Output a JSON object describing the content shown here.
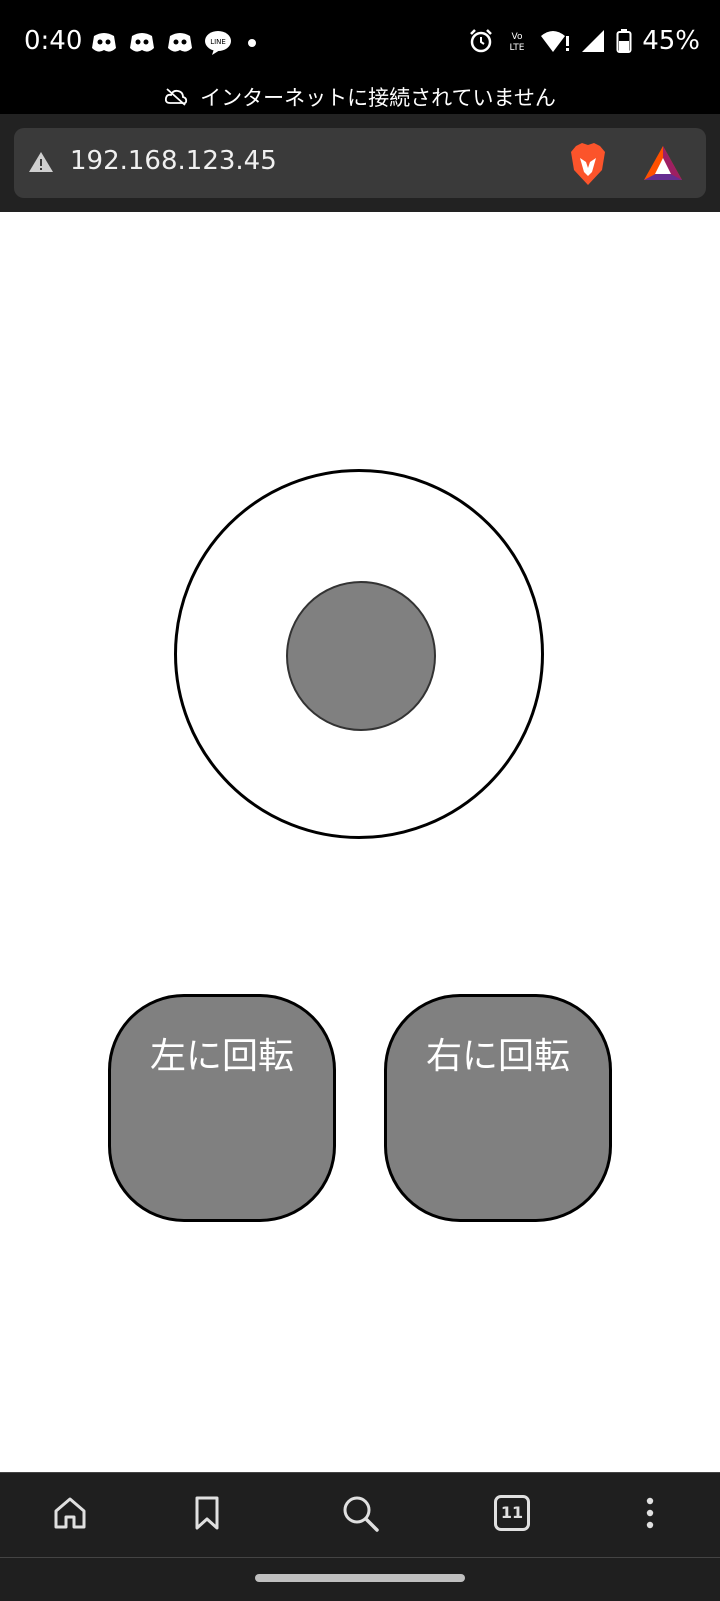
{
  "status_bar": {
    "time": "0:40",
    "battery": "45%",
    "notification_icons": [
      "discord-icon",
      "discord-icon",
      "discord-icon",
      "line-icon",
      "dot-icon"
    ],
    "system_icons": [
      "alarm-icon",
      "volte-icon",
      "wifi-icon",
      "signal-icon",
      "battery-icon"
    ]
  },
  "offline_banner": {
    "text": "インターネットに接続されていません"
  },
  "browser": {
    "url": "192.168.123.45",
    "icons": [
      "warning-icon",
      "brave-shields-icon",
      "brave-rewards-icon"
    ]
  },
  "controls": {
    "rotate_left_label": "左に回転",
    "rotate_right_label": "右に回転"
  },
  "bottom_nav": {
    "tabs_count": "11",
    "icons": [
      "home-icon",
      "bookmark-icon",
      "search-icon",
      "tabs-icon",
      "more-icon"
    ]
  },
  "colors": {
    "button_fill": "#808080",
    "knob_fill": "#808080",
    "brave_orange": "#fb542b"
  }
}
